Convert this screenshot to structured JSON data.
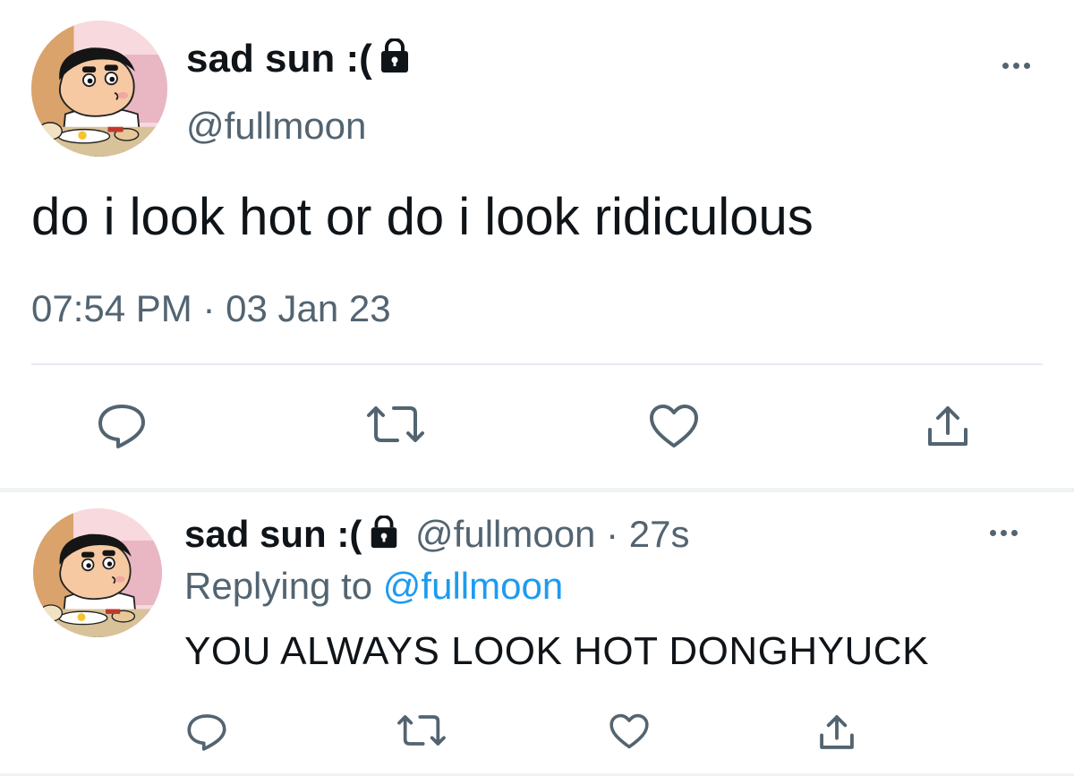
{
  "main_tweet": {
    "display_name": "sad sun :(",
    "handle": "@fullmoon",
    "text": "do i look hot or do i look ridiculous",
    "time": "07:54 PM",
    "separator": "·",
    "date": "03 Jan 23",
    "lock_icon": "lock-icon",
    "more_icon": "more-icon"
  },
  "reply_tweet": {
    "display_name": "sad sun :(",
    "handle": "@fullmoon",
    "separator": "·",
    "age": "27s",
    "replying_prefix": "Replying to",
    "replying_to": "@fullmoon",
    "text": "YOU ALWAYS LOOK HOT DONGHYUCK",
    "lock_icon": "lock-icon",
    "more_icon": "more-icon"
  },
  "actions": [
    "reply-icon",
    "retweet-icon",
    "like-icon",
    "share-icon"
  ],
  "colors": {
    "text_primary": "#0f1419",
    "text_secondary": "#536471",
    "link": "#1d9bf0",
    "divider": "#eff3f4"
  }
}
